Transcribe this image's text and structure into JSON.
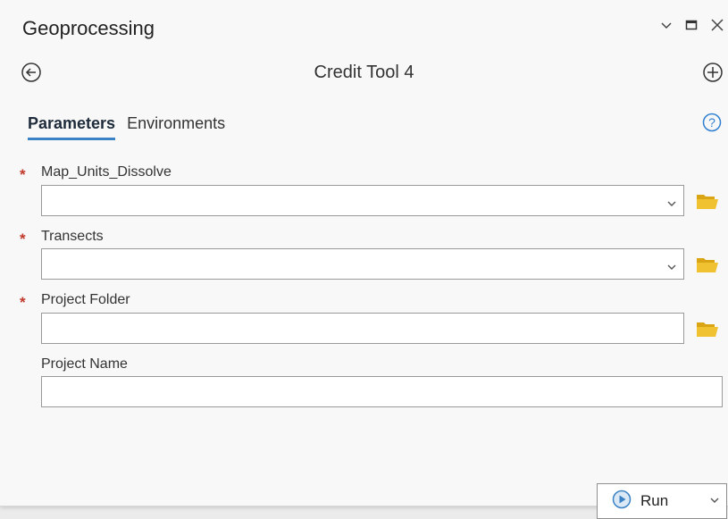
{
  "panel": {
    "title": "Geoprocessing",
    "window_controls": [
      "chevron-down-icon",
      "maximize-icon",
      "close-icon"
    ]
  },
  "tool": {
    "name": "Credit Tool 4",
    "back_icon": "back-arrow-icon",
    "add_icon": "add-icon"
  },
  "tabs": {
    "parameters": "Parameters",
    "environments": "Environments",
    "active": "Parameters",
    "help_icon": "help-icon"
  },
  "params": [
    {
      "label": "Map_Units_Dissolve",
      "required": true,
      "required_mark": "*",
      "type": "dropdown",
      "value": "",
      "browse": true
    },
    {
      "label": "Transects",
      "required": true,
      "required_mark": "*",
      "type": "dropdown",
      "value": "",
      "browse": true
    },
    {
      "label": "Project Folder",
      "required": true,
      "required_mark": "*",
      "type": "text",
      "value": "",
      "browse": true
    },
    {
      "label": "Project Name",
      "required": false,
      "required_mark": "",
      "type": "text",
      "value": "",
      "browse": false
    }
  ],
  "run": {
    "label": "Run"
  },
  "colors": {
    "accent": "#3b82c4",
    "required": "#c0392b",
    "folder": "#e8b820"
  }
}
